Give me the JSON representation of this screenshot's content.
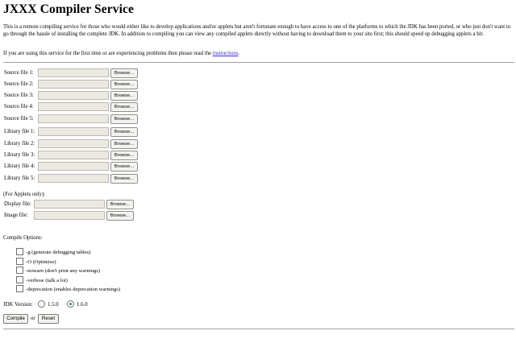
{
  "title": "JXXX Compiler Service",
  "intro": "This is a remote compiling service for those who would either like to develop applications and/or applets but aren't fortunate enough to have access to one of the platforms to which the JDK has been ported, or who just don't want to go through the hassle of installing the complete JDK. In addition to compiling you can view any compiled applets directly without having to download them to your site first; this should speed up debugging applets a bit.",
  "note": {
    "prefix": "If you are using this service for the first time or are experiencing problems then please read the ",
    "link": "instructions",
    "suffix": "."
  },
  "browse_label": "Browse...",
  "source_files": [
    {
      "label": "Source file 1:",
      "value": ""
    },
    {
      "label": "Source file 2:",
      "value": ""
    },
    {
      "label": "Source file 3:",
      "value": ""
    },
    {
      "label": "Source file 4:",
      "value": ""
    },
    {
      "label": "Source file 5:",
      "value": ""
    }
  ],
  "library_files": [
    {
      "label": "Library file 1:",
      "value": ""
    },
    {
      "label": "Library file 2:",
      "value": ""
    },
    {
      "label": "Library file 3:",
      "value": ""
    },
    {
      "label": "Library file 4:",
      "value": ""
    },
    {
      "label": "Library file 5:",
      "value": ""
    }
  ],
  "applets": {
    "heading": "(For Applets only):",
    "display_label": "Display file:",
    "image_label": "Image file:"
  },
  "compile_options": {
    "heading": "Compile Options:",
    "options": [
      {
        "label": "-g (generate debugging tables)",
        "checked": false
      },
      {
        "label": "-O (Optimize)",
        "checked": false
      },
      {
        "label": "-nowarn (don't print any warnings)",
        "checked": false
      },
      {
        "label": "-verbose (talk a lot)",
        "checked": false
      },
      {
        "label": "-deprecation (enables deprecation warnings)",
        "checked": false
      }
    ]
  },
  "jdk": {
    "label": "JDK Version:",
    "options": [
      "1.5.0",
      "1.6.0"
    ],
    "selected": "1.6.0"
  },
  "actions": {
    "compile": "Compile",
    "or": "or",
    "reset": "Reset"
  }
}
